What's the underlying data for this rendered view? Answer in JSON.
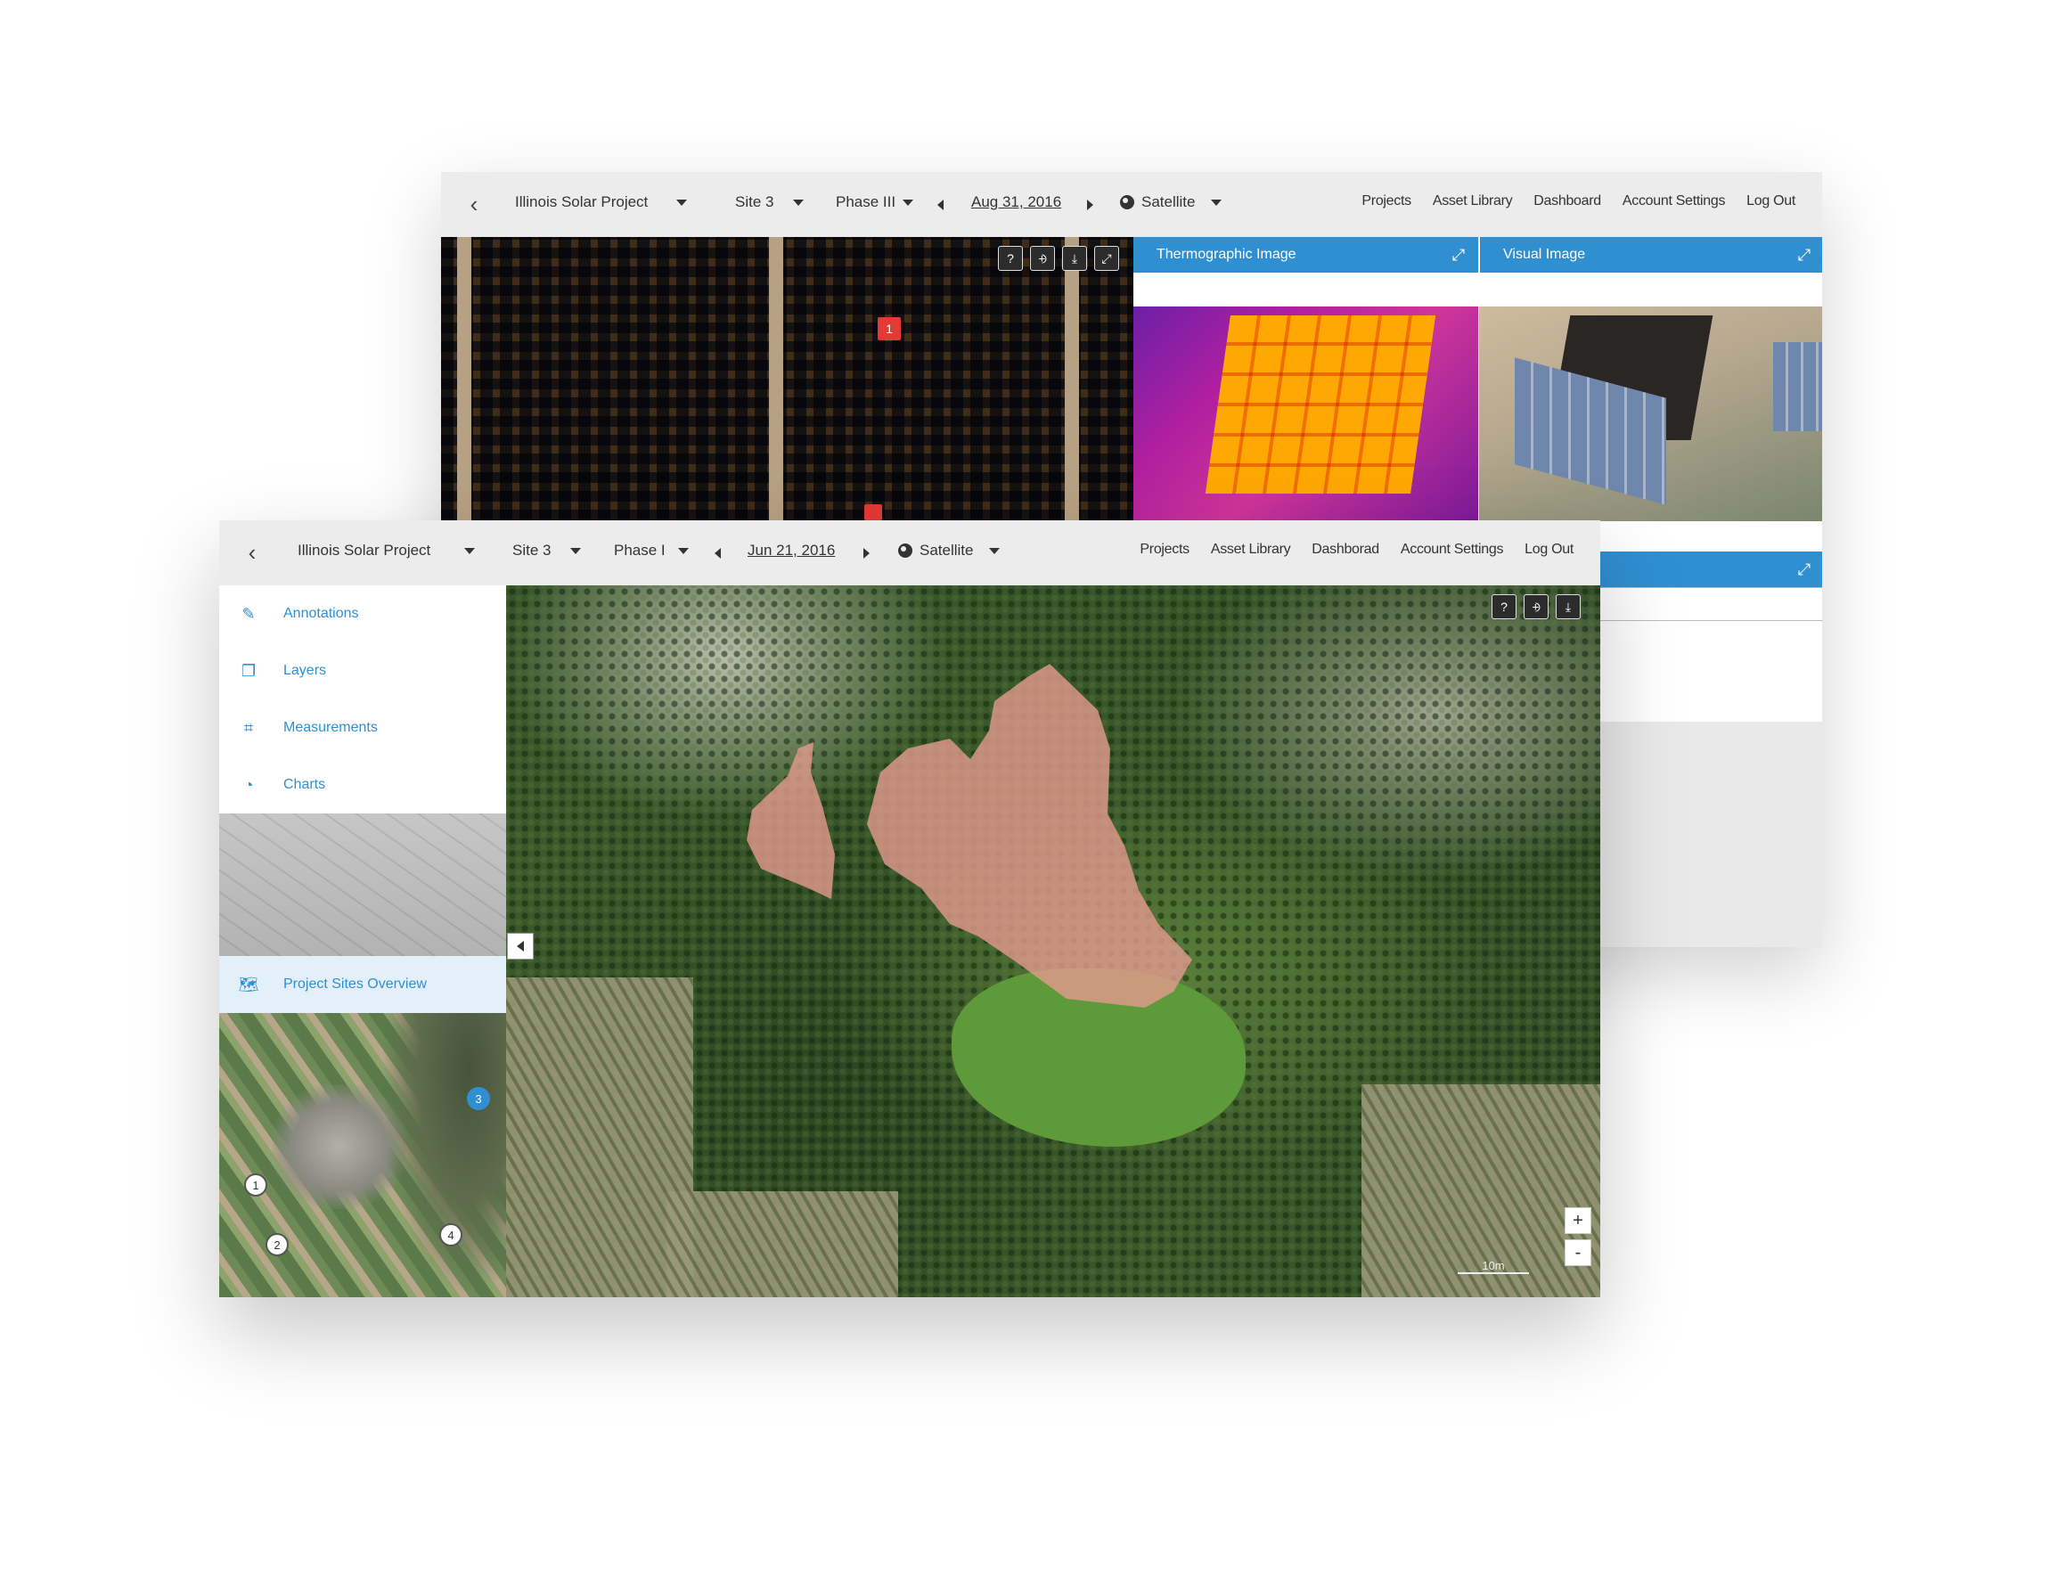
{
  "back_window": {
    "project": "Illinois Solar Project",
    "site": "Site 3",
    "phase": "Phase III",
    "date": "Aug 31, 2016",
    "basemap": "Satellite",
    "nav": [
      "Projects",
      "Asset Library",
      "Dashboard",
      "Account Settings",
      "Log Out"
    ],
    "marker": "1",
    "panels": {
      "thermographic_title": "Thermographic Image",
      "visual_title": "Visual Image"
    }
  },
  "front_window": {
    "project": "Illinois Solar Project",
    "site": "Site 3",
    "phase": "Phase I",
    "date": "Jun 21, 2016",
    "basemap": "Satellite",
    "nav": [
      "Projects",
      "Asset Library",
      "Dashborad",
      "Account Settings",
      "Log Out"
    ],
    "sidebar": {
      "items": [
        {
          "label": "Annotations",
          "icon": "edit-icon"
        },
        {
          "label": "Layers",
          "icon": "layers-icon"
        },
        {
          "label": "Measurements",
          "icon": "measure-icon"
        },
        {
          "label": "Charts",
          "icon": "pie-chart-icon"
        }
      ],
      "overview_label": "Project Sites Overview",
      "site_pins": [
        "1",
        "2",
        "3",
        "4"
      ]
    },
    "zoom": {
      "in": "+",
      "out": "-"
    },
    "scale": "10m"
  },
  "colors": {
    "accent": "#2f8fd1",
    "highlight_area": "#e09a8c",
    "marker": "#e53935"
  }
}
